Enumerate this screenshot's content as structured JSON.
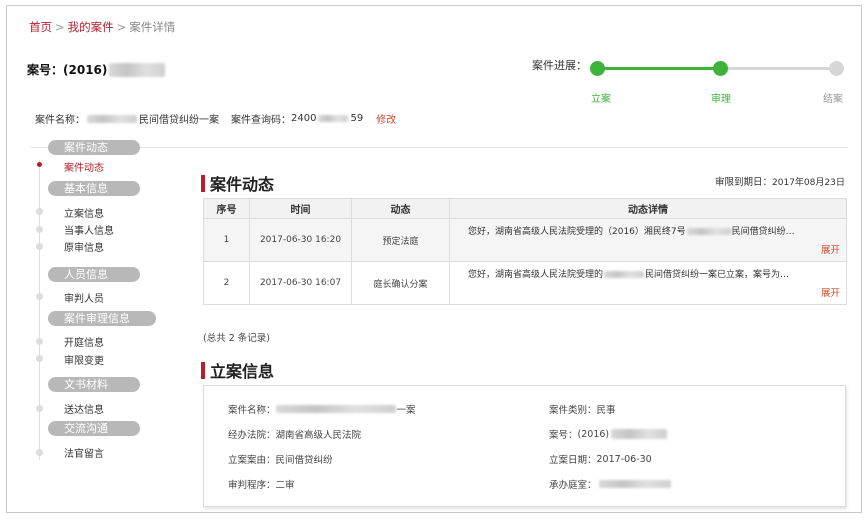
{
  "breadcrumb": {
    "home": "首页",
    "sep": ">",
    "my_cases": "我的案件",
    "current": "案件详情"
  },
  "case_header": {
    "case_no_label": "案号：",
    "case_no_prefix": "(2016)"
  },
  "progress": {
    "label": "案件进展：",
    "steps": [
      {
        "label": "立案",
        "status": "done"
      },
      {
        "label": "审理",
        "status": "done"
      },
      {
        "label": "结案",
        "status": "todo"
      }
    ],
    "colors": {
      "done": "#3db339",
      "todo": "#d6d6d6"
    }
  },
  "case_meta": {
    "name_label": "案件名称：",
    "name_visible": "民间借贷纠纷一案",
    "query_label": "案件查询码：",
    "query_prefix": "2400",
    "query_suffix": "59",
    "edit_label": "修改"
  },
  "sidebar": {
    "groups": [
      {
        "title": "案件动态",
        "items": [
          {
            "label": "案件动态",
            "active": true
          }
        ]
      },
      {
        "title": "基本信息",
        "items": [
          {
            "label": "立案信息"
          },
          {
            "label": "当事人信息"
          },
          {
            "label": "原审信息"
          }
        ]
      },
      {
        "title": "人员信息",
        "items": [
          {
            "label": "审判人员"
          }
        ]
      },
      {
        "title": "案件审理信息",
        "items": [
          {
            "label": "开庭信息"
          },
          {
            "label": "审限变更"
          }
        ]
      },
      {
        "title": "文书材料",
        "items": [
          {
            "label": "送达信息"
          }
        ]
      },
      {
        "title": "交流沟通",
        "items": [
          {
            "label": "法官留言"
          }
        ]
      }
    ]
  },
  "dynamics": {
    "title": "案件动态",
    "deadline_label": "审限到期日：",
    "deadline_value": "2017年08月23日",
    "columns": [
      "序号",
      "时间",
      "动态",
      "动态详情"
    ],
    "rows": [
      {
        "no": "1",
        "time": "2017-06-30 16:20",
        "event": "预定法庭",
        "detail_pre": "您好，湖南省高级人民法院受理的（2016）湘民终7号",
        "detail_post": "民间借贷纠纷…",
        "expand": "展开"
      },
      {
        "no": "2",
        "time": "2017-06-30 16:07",
        "event": "庭长确认分案",
        "detail_pre": "您好，湖南省高级人民法院受理的",
        "detail_post": "民间借贷纠纷一案已立案，案号为…",
        "expand": "展开"
      }
    ],
    "total": "(总共 2 条记录)"
  },
  "filing": {
    "title": "立案信息",
    "left": [
      {
        "label": "案件名称：",
        "value": "一案"
      },
      {
        "label": "经办法院：",
        "value": "湖南省高级人民法院"
      },
      {
        "label": "立案案由：",
        "value": "民间借贷纠纷"
      },
      {
        "label": "审判程序：",
        "value": "二审"
      }
    ],
    "right": [
      {
        "label": "案件类别：",
        "value": "民事"
      },
      {
        "label": "案号：",
        "value": "(2016)"
      },
      {
        "label": "立案日期：",
        "value": "2017-06-30"
      },
      {
        "label": "承办庭室：",
        "value": ""
      }
    ]
  },
  "colors": {
    "accent": "#b51f2b",
    "link_red": "#d24b2b",
    "progress_green": "#3db339"
  }
}
